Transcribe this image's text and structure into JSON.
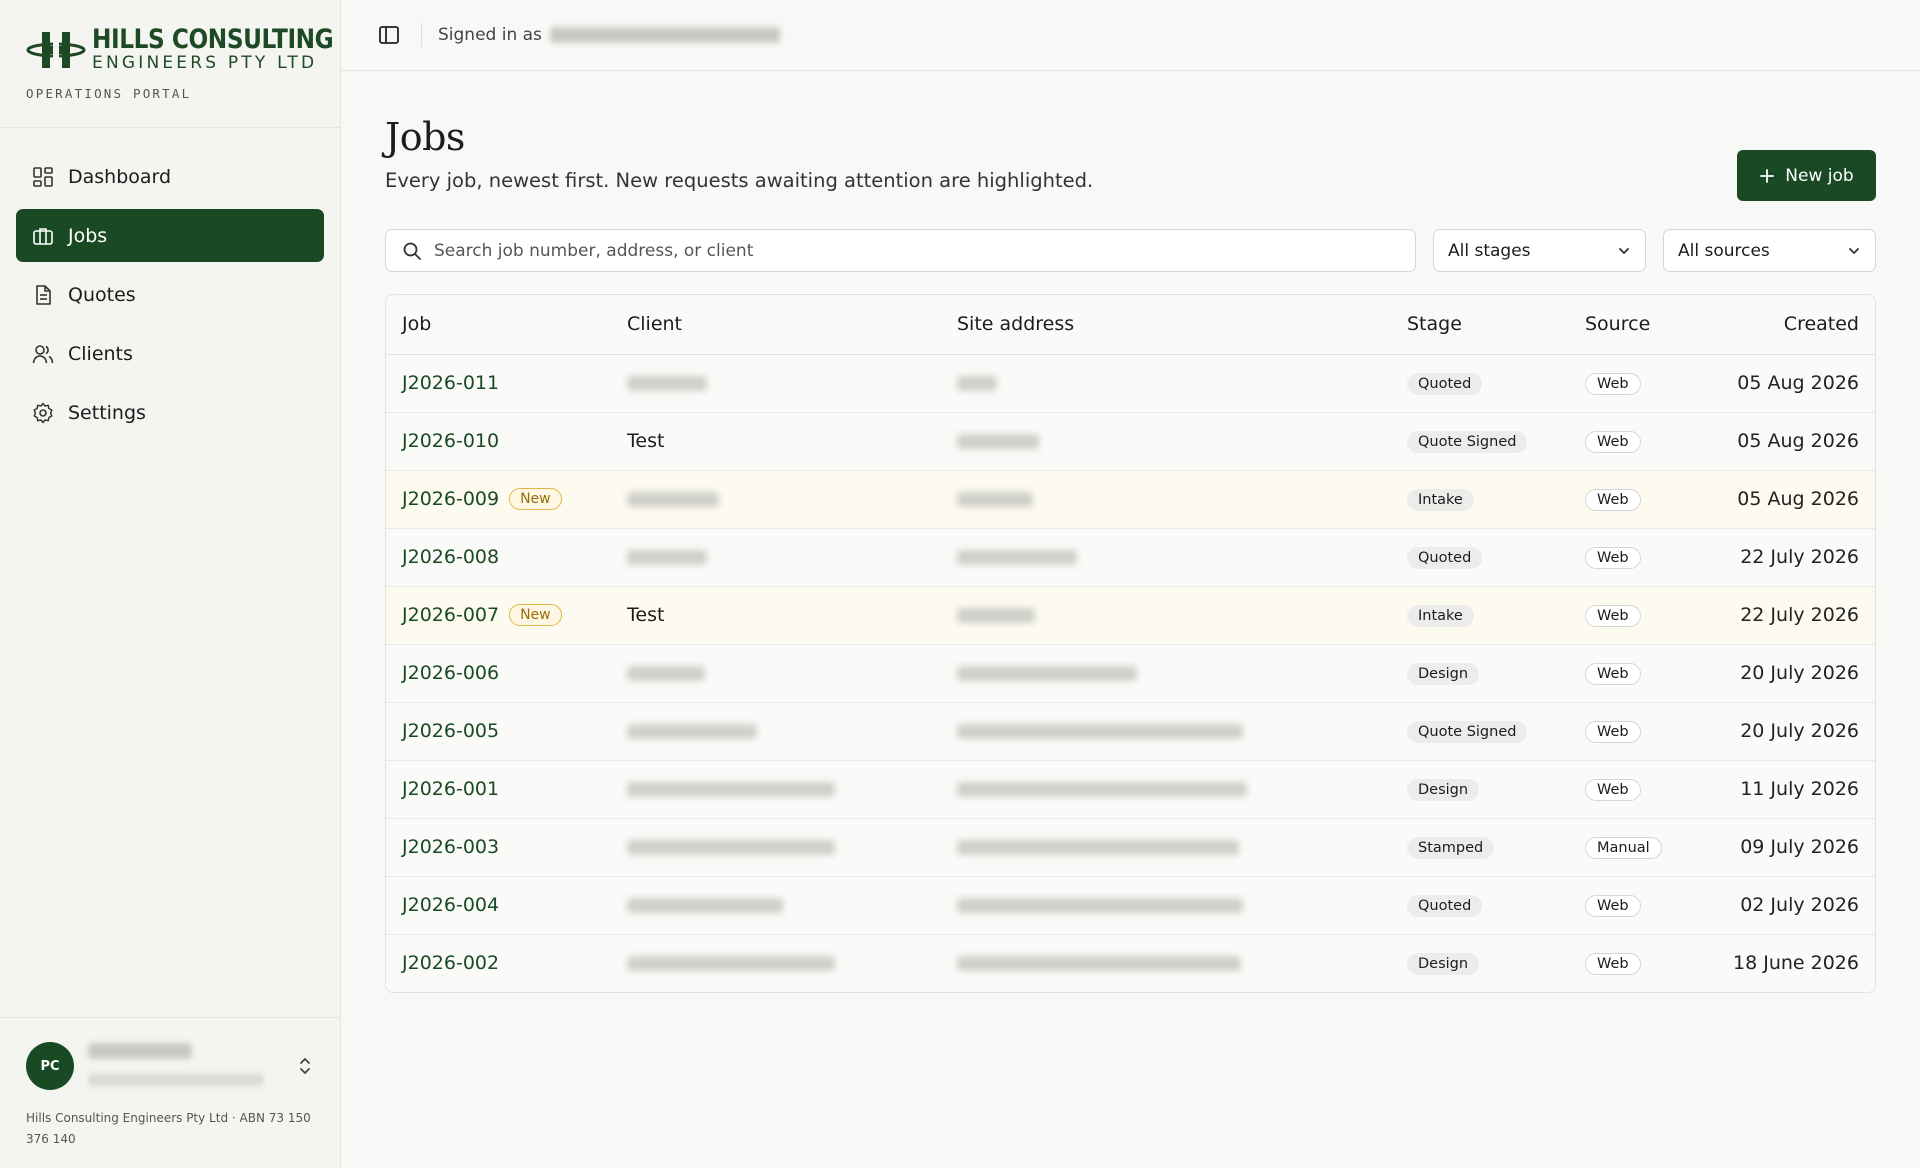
{
  "brand": {
    "name": "HILLS CONSULTING",
    "sub": "ENGINEERS PTY LTD",
    "portal": "OPERATIONS PORTAL",
    "color": "#1d4a25"
  },
  "nav": {
    "items": [
      {
        "label": "Dashboard",
        "icon": "dashboard-icon",
        "active": false
      },
      {
        "label": "Jobs",
        "icon": "briefcase-icon",
        "active": true
      },
      {
        "label": "Quotes",
        "icon": "document-icon",
        "active": false
      },
      {
        "label": "Clients",
        "icon": "users-icon",
        "active": false
      },
      {
        "label": "Settings",
        "icon": "gear-icon",
        "active": false
      }
    ]
  },
  "user": {
    "initials": "PC"
  },
  "legal": "Hills Consulting Engineers Pty Ltd · ABN 73 150 376 140",
  "topbar": {
    "signed_in_label": "Signed in as"
  },
  "page": {
    "title": "Jobs",
    "description": "Every job, newest first. New requests awaiting attention are highlighted.",
    "new_job_label": "New job"
  },
  "filters": {
    "search_placeholder": "Search job number, address, or client",
    "stage_value": "All stages",
    "source_value": "All sources"
  },
  "table": {
    "headers": {
      "job": "Job",
      "client": "Client",
      "site": "Site address",
      "stage": "Stage",
      "source": "Source",
      "created": "Created"
    },
    "new_badge_label": "New",
    "rows": [
      {
        "job": "J2026-011",
        "new": false,
        "client": "",
        "stage": "Quoted",
        "source": "Web",
        "created": "05 Aug 2026"
      },
      {
        "job": "J2026-010",
        "new": false,
        "client": "Test",
        "stage": "Quote Signed",
        "source": "Web",
        "created": "05 Aug 2026"
      },
      {
        "job": "J2026-009",
        "new": true,
        "client": "",
        "stage": "Intake",
        "source": "Web",
        "created": "05 Aug 2026"
      },
      {
        "job": "J2026-008",
        "new": false,
        "client": "",
        "stage": "Quoted",
        "source": "Web",
        "created": "22 July 2026"
      },
      {
        "job": "J2026-007",
        "new": true,
        "client": "Test",
        "stage": "Intake",
        "source": "Web",
        "created": "22 July 2026"
      },
      {
        "job": "J2026-006",
        "new": false,
        "client": "",
        "stage": "Design",
        "source": "Web",
        "created": "20 July 2026"
      },
      {
        "job": "J2026-005",
        "new": false,
        "client": "",
        "stage": "Quote Signed",
        "source": "Web",
        "created": "20 July 2026"
      },
      {
        "job": "J2026-001",
        "new": false,
        "client": "",
        "stage": "Design",
        "source": "Web",
        "created": "11 July 2026"
      },
      {
        "job": "J2026-003",
        "new": false,
        "client": "",
        "stage": "Stamped",
        "source": "Manual",
        "created": "09 July 2026"
      },
      {
        "job": "J2026-004",
        "new": false,
        "client": "",
        "stage": "Quoted",
        "source": "Web",
        "created": "02 July 2026"
      },
      {
        "job": "J2026-002",
        "new": false,
        "client": "",
        "stage": "Design",
        "source": "Web",
        "created": "18 June 2026"
      }
    ]
  },
  "colors": {
    "accent": "#1a4a24",
    "highlight_row": "#fdfbf0",
    "new_badge_border": "#e0b84a"
  }
}
